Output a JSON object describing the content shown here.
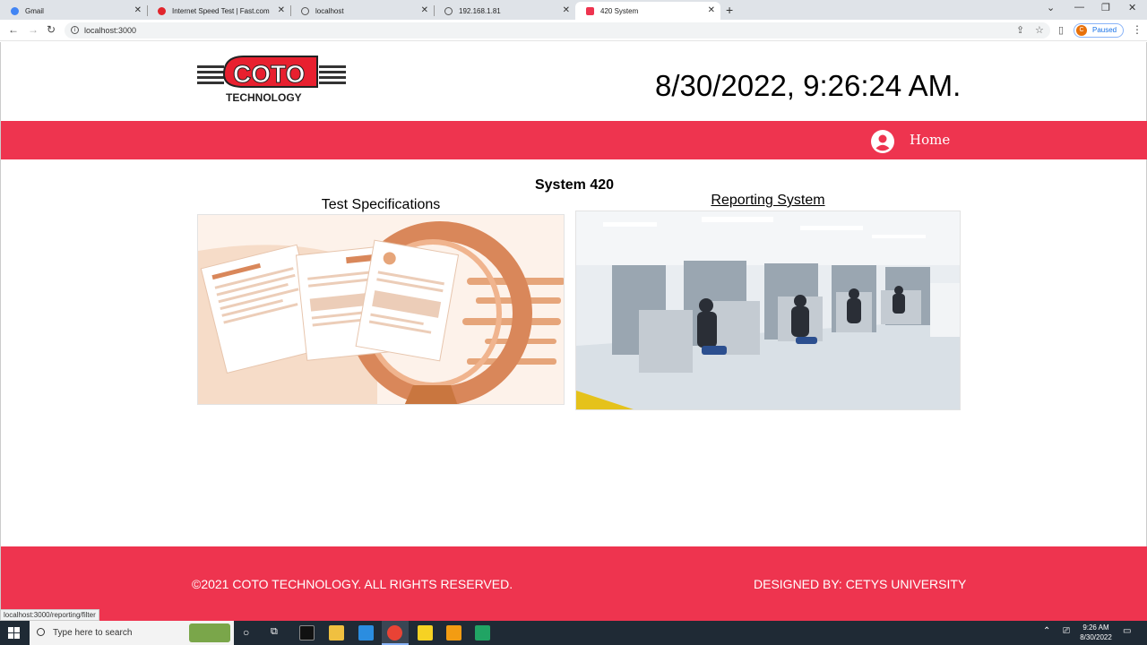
{
  "browser": {
    "tabs": [
      {
        "title": "Gmail",
        "icon": "gmail-icon"
      },
      {
        "title": "Internet Speed Test | Fast.com",
        "icon": "fast-icon"
      },
      {
        "title": "localhost",
        "icon": "globe-icon"
      },
      {
        "title": "192.168.1.81",
        "icon": "globe-icon"
      },
      {
        "title": "420 System",
        "icon": "coto-icon"
      }
    ],
    "url": "localhost:3000",
    "profile_status": "Paused",
    "profile_initial": "C"
  },
  "page": {
    "datetime": "8/30/2022, 9:26:24 AM.",
    "nav": {
      "home_label": "Home"
    },
    "system_title": "System 420",
    "cards": [
      {
        "title": "Test Specifications",
        "image": "documents-illustration"
      },
      {
        "title": "Reporting System",
        "image": "factory-photo"
      }
    ],
    "footer": {
      "copyright": "©2021 COTO TECHNOLOGY. ALL RIGHTS RESERVED.",
      "designer": "DESIGNED BY: CETYS UNIVERSITY"
    },
    "brand_color": "#ee344f"
  },
  "status_url": "localhost:3000/reporting/filter",
  "taskbar": {
    "search_placeholder": "Type here to search",
    "time": "9:26 AM",
    "date": "8/30/2022"
  }
}
